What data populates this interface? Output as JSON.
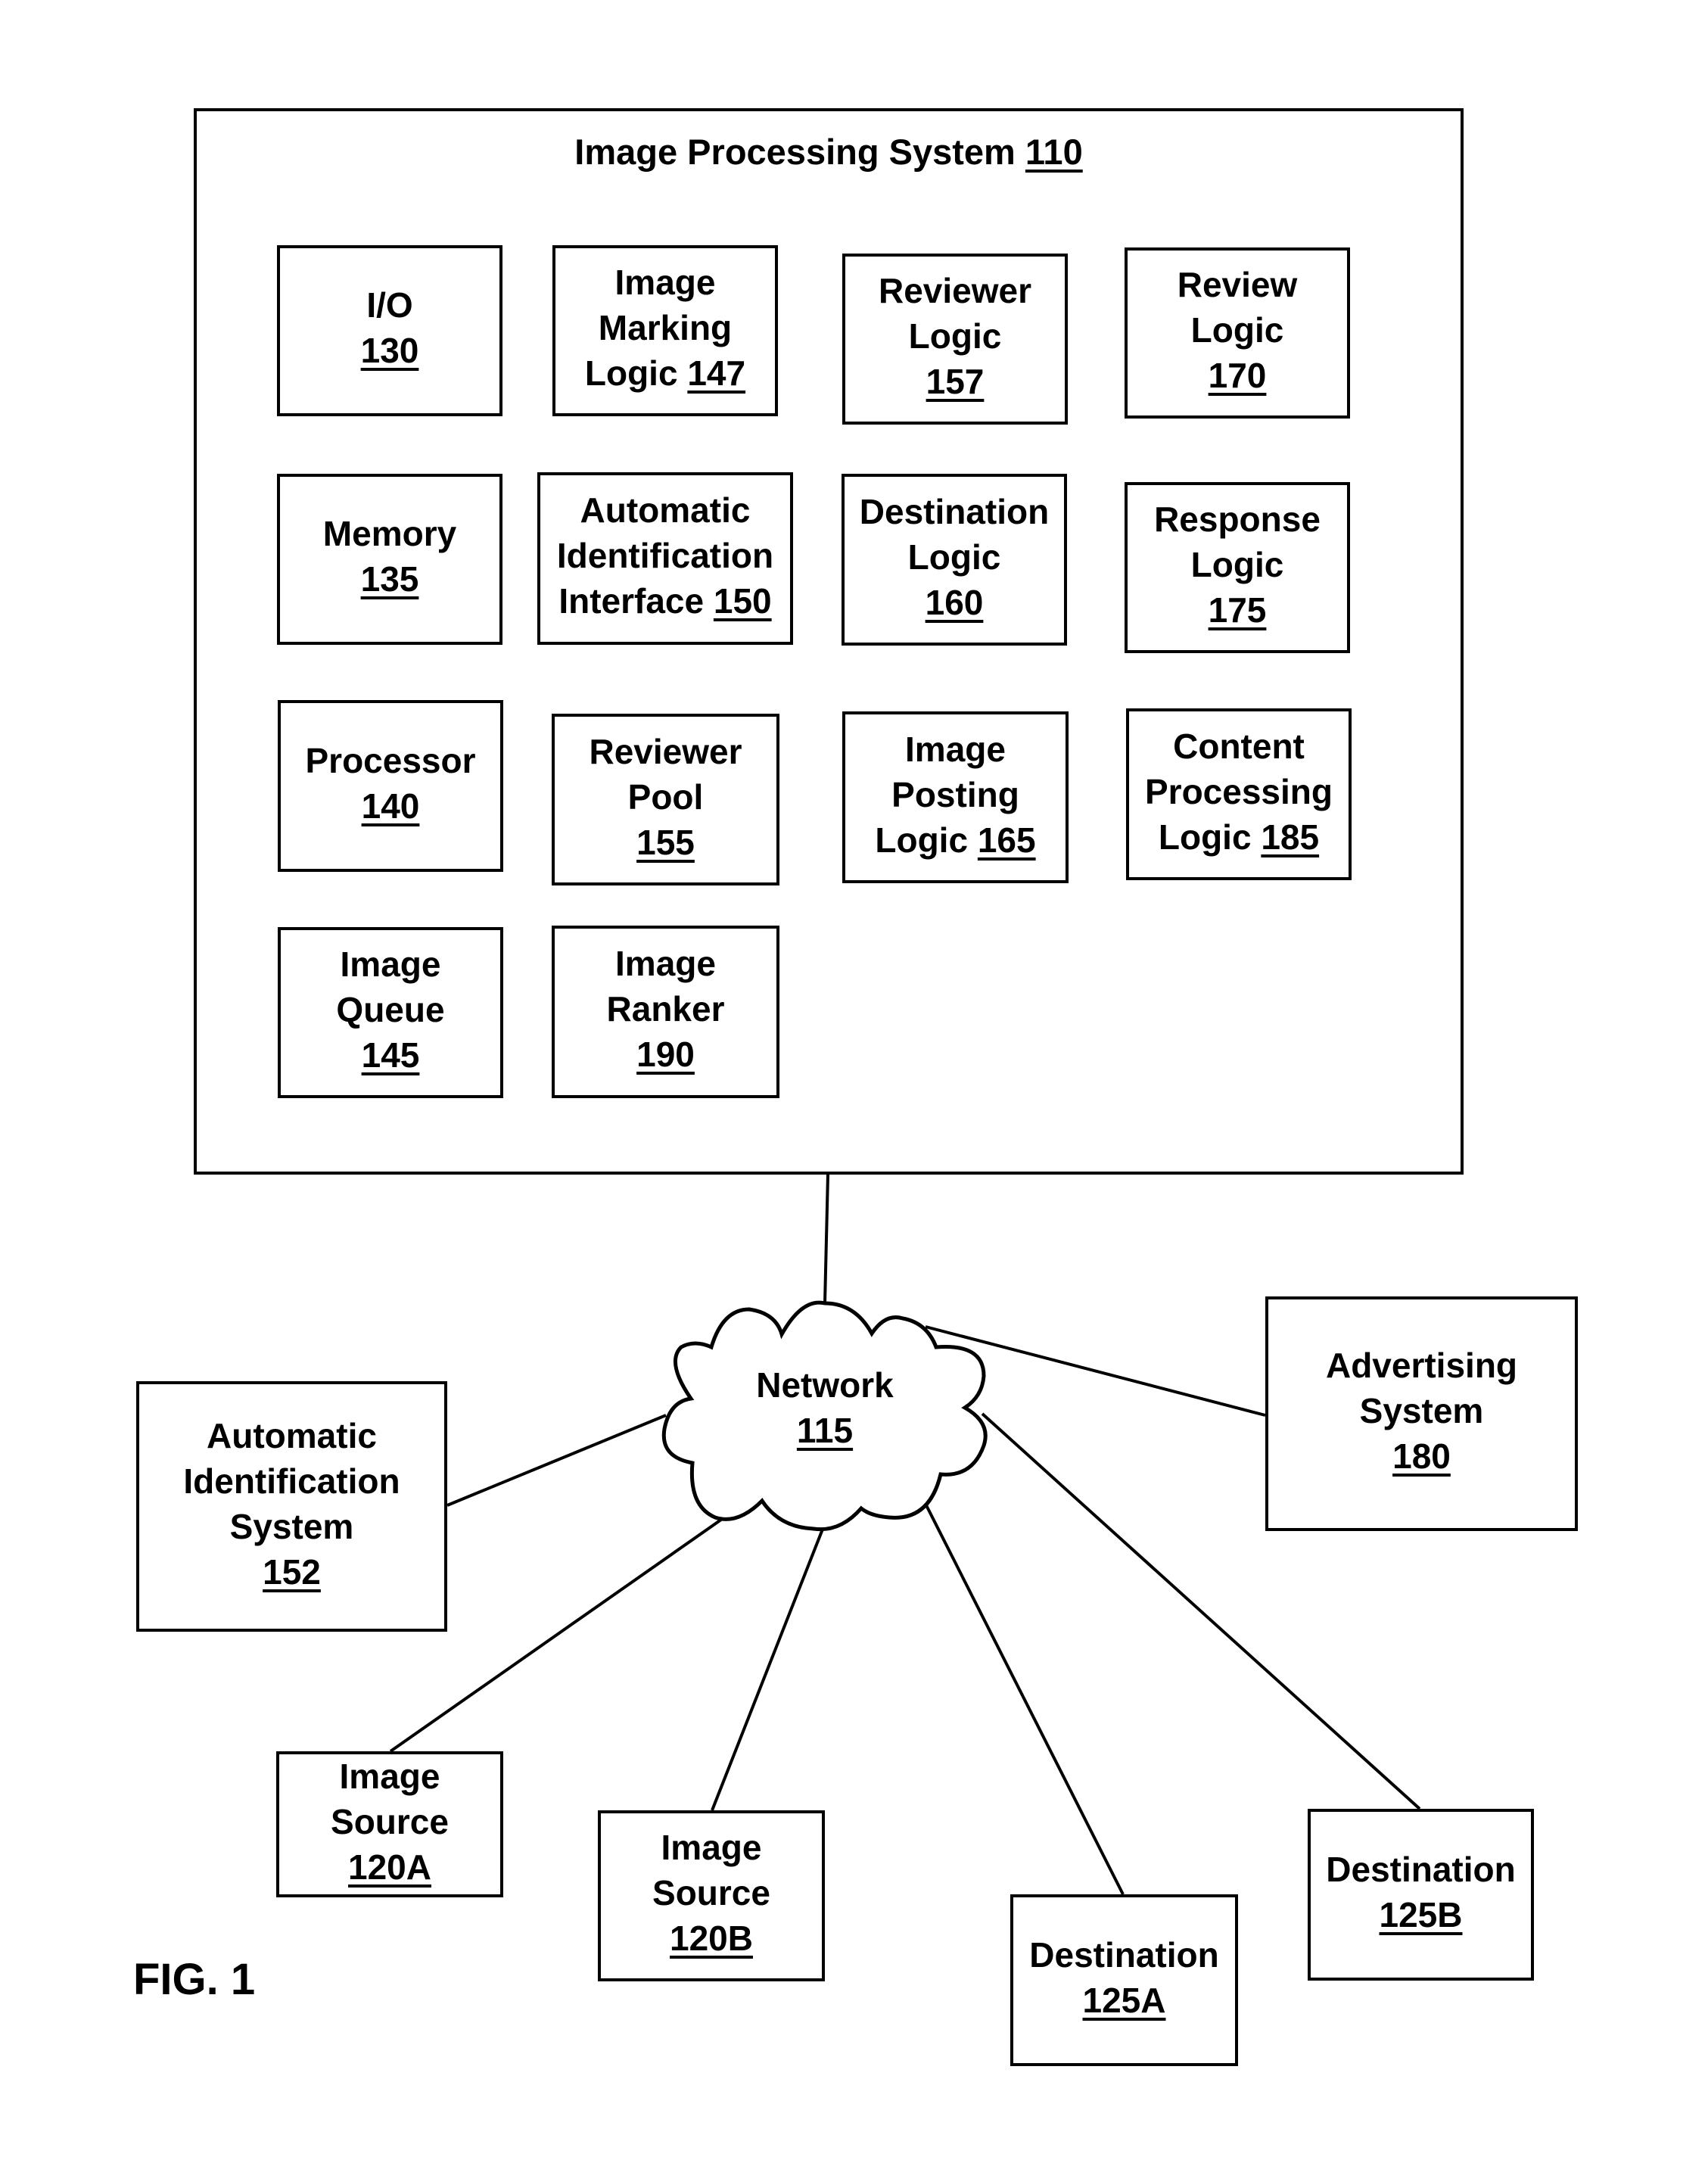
{
  "figure_label": "FIG. 1",
  "image_processing_system": {
    "title": "Image Processing System",
    "ref": "110",
    "components": [
      {
        "id": "io",
        "lines": [
          {
            "text": "I/O",
            "ref": ""
          },
          {
            "text": "",
            "ref": "130"
          }
        ]
      },
      {
        "id": "image-marking-logic",
        "lines": [
          {
            "text": "Image",
            "ref": ""
          },
          {
            "text": "Marking",
            "ref": ""
          },
          {
            "text": "Logic",
            "ref": "147"
          }
        ]
      },
      {
        "id": "reviewer-logic",
        "lines": [
          {
            "text": "Reviewer",
            "ref": ""
          },
          {
            "text": "Logic",
            "ref": ""
          },
          {
            "text": "",
            "ref": "157"
          }
        ]
      },
      {
        "id": "review-logic",
        "lines": [
          {
            "text": "Review",
            "ref": ""
          },
          {
            "text": "Logic",
            "ref": ""
          },
          {
            "text": "",
            "ref": "170"
          }
        ]
      },
      {
        "id": "memory",
        "lines": [
          {
            "text": "Memory",
            "ref": ""
          },
          {
            "text": "",
            "ref": "135"
          }
        ]
      },
      {
        "id": "automatic-identification-interface",
        "lines": [
          {
            "text": "Automatic",
            "ref": ""
          },
          {
            "text": "Identification",
            "ref": ""
          },
          {
            "text": "Interface",
            "ref": "150"
          }
        ]
      },
      {
        "id": "destination-logic",
        "lines": [
          {
            "text": "Destination",
            "ref": ""
          },
          {
            "text": "Logic",
            "ref": ""
          },
          {
            "text": "",
            "ref": "160"
          }
        ]
      },
      {
        "id": "response-logic",
        "lines": [
          {
            "text": "Response",
            "ref": ""
          },
          {
            "text": "Logic",
            "ref": ""
          },
          {
            "text": "",
            "ref": "175"
          }
        ]
      },
      {
        "id": "processor",
        "lines": [
          {
            "text": "Processor",
            "ref": ""
          },
          {
            "text": "",
            "ref": "140"
          }
        ]
      },
      {
        "id": "reviewer-pool",
        "lines": [
          {
            "text": "Reviewer",
            "ref": ""
          },
          {
            "text": "Pool",
            "ref": ""
          },
          {
            "text": "",
            "ref": "155"
          }
        ]
      },
      {
        "id": "image-posting-logic",
        "lines": [
          {
            "text": "Image",
            "ref": ""
          },
          {
            "text": "Posting",
            "ref": ""
          },
          {
            "text": "Logic",
            "ref": "165"
          }
        ]
      },
      {
        "id": "content-processing-logic",
        "lines": [
          {
            "text": "Content",
            "ref": ""
          },
          {
            "text": "Processing",
            "ref": ""
          },
          {
            "text": "Logic",
            "ref": "185"
          }
        ]
      },
      {
        "id": "image-queue",
        "lines": [
          {
            "text": "Image",
            "ref": ""
          },
          {
            "text": "Queue",
            "ref": ""
          },
          {
            "text": "",
            "ref": "145"
          }
        ]
      },
      {
        "id": "image-ranker",
        "lines": [
          {
            "text": "Image",
            "ref": ""
          },
          {
            "text": "Ranker",
            "ref": ""
          },
          {
            "text": "",
            "ref": "190"
          }
        ]
      }
    ]
  },
  "network": {
    "lines": [
      {
        "text": "Network",
        "ref": ""
      },
      {
        "text": "",
        "ref": "115"
      }
    ]
  },
  "external_systems": [
    {
      "id": "automatic-identification-system",
      "lines": [
        {
          "text": "Automatic",
          "ref": ""
        },
        {
          "text": "Identification",
          "ref": ""
        },
        {
          "text": "System",
          "ref": ""
        },
        {
          "text": "",
          "ref": "152"
        }
      ]
    },
    {
      "id": "advertising-system",
      "lines": [
        {
          "text": "Advertising",
          "ref": ""
        },
        {
          "text": "System",
          "ref": ""
        },
        {
          "text": "",
          "ref": "180"
        }
      ]
    },
    {
      "id": "image-source-120a",
      "lines": [
        {
          "text": "Image",
          "ref": ""
        },
        {
          "text": "Source",
          "ref": ""
        },
        {
          "text": "",
          "ref": "120A"
        }
      ]
    },
    {
      "id": "image-source-120b",
      "lines": [
        {
          "text": "Image",
          "ref": ""
        },
        {
          "text": "Source",
          "ref": ""
        },
        {
          "text": "",
          "ref": "120B"
        }
      ]
    },
    {
      "id": "destination-125a",
      "lines": [
        {
          "text": "Destination",
          "ref": ""
        },
        {
          "text": "",
          "ref": "125A"
        }
      ]
    },
    {
      "id": "destination-125b",
      "lines": [
        {
          "text": "Destination",
          "ref": ""
        },
        {
          "text": "",
          "ref": "125B"
        }
      ]
    }
  ],
  "connections": [
    {
      "from": "image-processing-system",
      "to": "network"
    },
    {
      "from": "automatic-identification-system",
      "to": "network"
    },
    {
      "from": "advertising-system",
      "to": "network"
    },
    {
      "from": "image-source-120a",
      "to": "network"
    },
    {
      "from": "image-source-120b",
      "to": "network"
    },
    {
      "from": "destination-125a",
      "to": "network"
    },
    {
      "from": "destination-125b",
      "to": "network"
    }
  ]
}
